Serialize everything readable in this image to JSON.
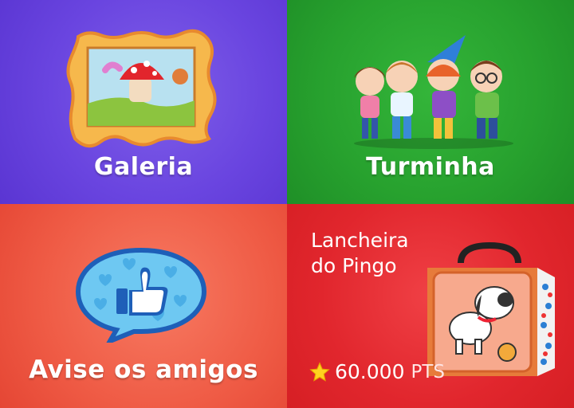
{
  "tiles": {
    "gallery": {
      "label": "Galeria",
      "icon": "framed-picture-icon",
      "color": "#6a45e0"
    },
    "friends": {
      "label": "Turminha",
      "icon": "characters-group-illustration",
      "color": "#27a12e"
    },
    "share": {
      "label": "Avise os amigos",
      "icon": "thumbs-up-speech-bubble-icon",
      "color": "#ef5b45"
    },
    "lunchbox": {
      "title_line1": "Lancheira",
      "title_line2": "do Pingo",
      "points": "60.000",
      "points_unit": "PTS",
      "icon": "lunchbox-icon",
      "star_icon": "star-icon",
      "color": "#e1262d"
    }
  }
}
